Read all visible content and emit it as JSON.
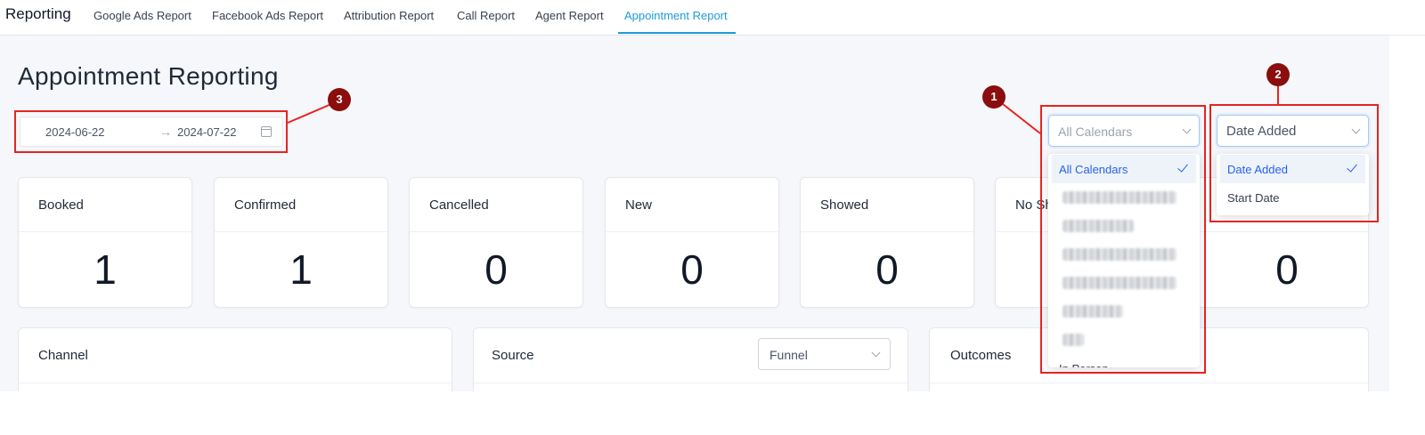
{
  "nav": {
    "brand": "Reporting",
    "tabs": [
      {
        "label": "Google Ads Report",
        "active": false
      },
      {
        "label": "Facebook Ads Report",
        "active": false
      },
      {
        "label": "Attribution Report",
        "active": false
      },
      {
        "label": "Call Report",
        "active": false
      },
      {
        "label": "Agent Report",
        "active": false
      },
      {
        "label": "Appointment Report",
        "active": true
      }
    ]
  },
  "page": {
    "title": "Appointment Reporting"
  },
  "date_range": {
    "start": "2024-06-22",
    "end": "2024-07-22",
    "separator": "→"
  },
  "stats": [
    {
      "label": "Booked",
      "value": "1"
    },
    {
      "label": "Confirmed",
      "value": "1"
    },
    {
      "label": "Cancelled",
      "value": "0"
    },
    {
      "label": "New",
      "value": "0"
    },
    {
      "label": "Showed",
      "value": "0"
    },
    {
      "label": "No Sh",
      "value": ""
    },
    {
      "label": "",
      "value": "0"
    }
  ],
  "panels": {
    "channel": "Channel",
    "source": "Source",
    "outcomes": "Outcomes",
    "source_filter": "Funnel"
  },
  "calendar_filter": {
    "placeholder": "All Calendars",
    "options": [
      {
        "label": "All Calendars",
        "selected": true
      },
      {
        "label": "",
        "blurred": true
      },
      {
        "label": "",
        "blurred": true
      },
      {
        "label": "",
        "blurred": true
      },
      {
        "label": "",
        "blurred": true
      },
      {
        "label": "",
        "blurred": true
      },
      {
        "label": "",
        "blurred": true
      },
      {
        "label": "In Person",
        "blurred": false
      }
    ]
  },
  "date_type_filter": {
    "value": "Date Added",
    "options": [
      {
        "label": "Date Added",
        "selected": true
      },
      {
        "label": "Start Date",
        "selected": false
      }
    ]
  },
  "annotations": {
    "marker_1": "1",
    "marker_2": "2",
    "marker_3": "3",
    "box_color": "#e52421",
    "marker_color": "#8b0d0d"
  },
  "colors": {
    "accent": "#1d9bd8",
    "selected_text": "#2563eb"
  }
}
